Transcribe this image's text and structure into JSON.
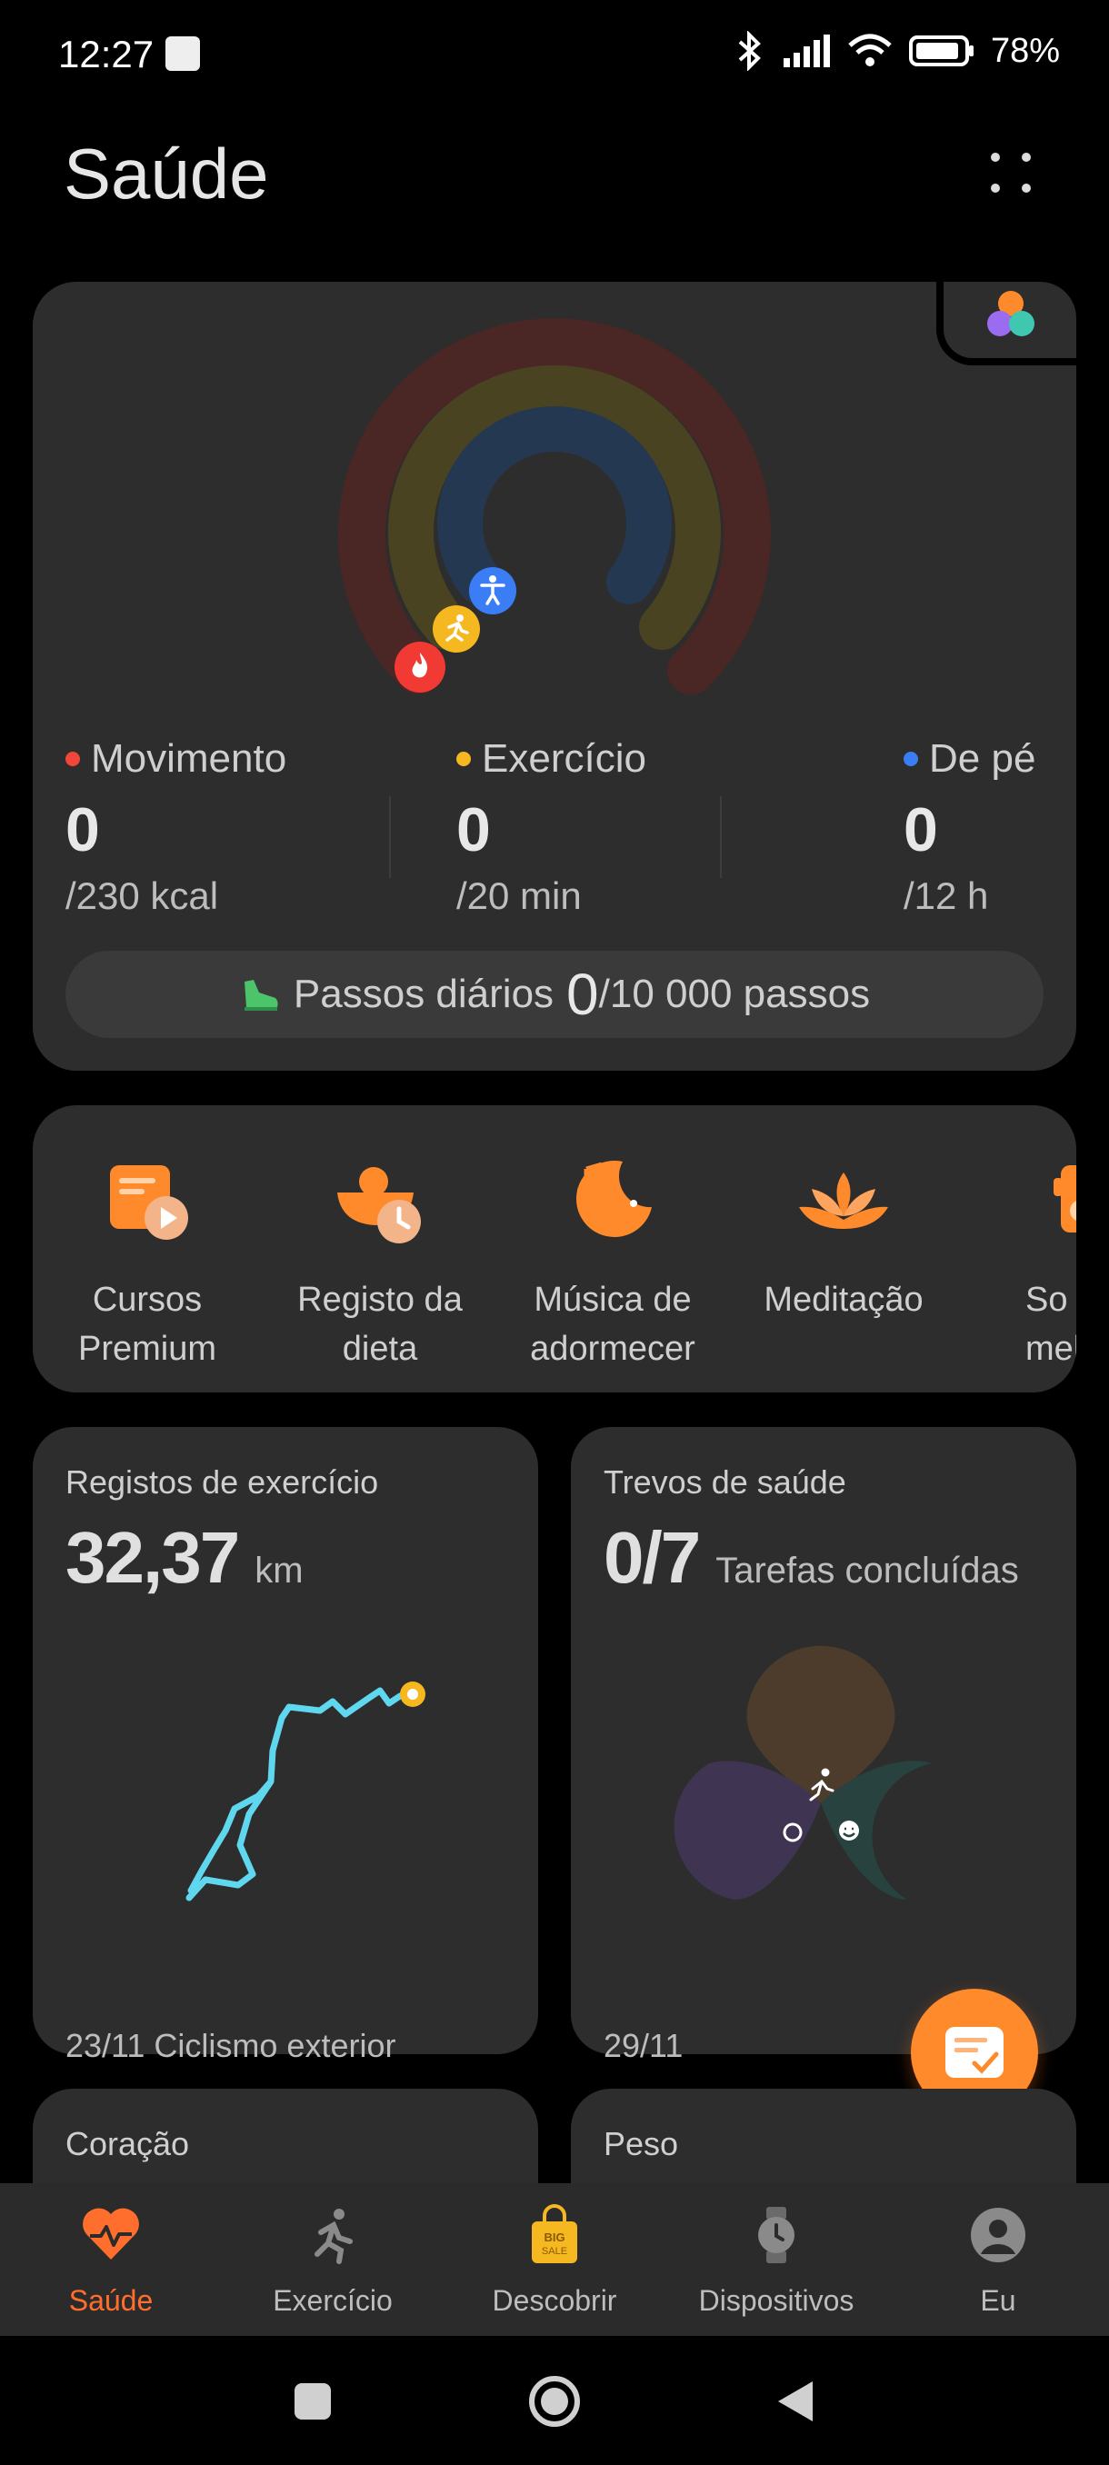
{
  "status_bar": {
    "time": "12:27",
    "battery": "78%"
  },
  "header": {
    "title": "Saúde"
  },
  "activity": {
    "stats": [
      {
        "label": "Movimento",
        "value": "0",
        "goal": "/230 kcal",
        "color": "#f0473a"
      },
      {
        "label": "Exercício",
        "value": "0",
        "goal": "/20 min",
        "color": "#f5b820"
      },
      {
        "label": "De pé",
        "value": "0",
        "goal": "/12 h",
        "color": "#3b7df5"
      }
    ],
    "steps": {
      "label": "Passos diários",
      "value": "0",
      "goal": "/10 000 passos"
    }
  },
  "shortcuts": [
    {
      "label_line1": "Cursos",
      "label_line2": "Premium"
    },
    {
      "label_line1": "Registo da",
      "label_line2": "dieta"
    },
    {
      "label_line1": "Música de",
      "label_line2": "adormecer"
    },
    {
      "label_line1": "Meditação",
      "label_line2": ""
    },
    {
      "label_line1": "So",
      "label_line2": "meló"
    }
  ],
  "exercise_tile": {
    "title": "Registos de exercício",
    "value": "32,37",
    "unit": "km",
    "footer": "23/11 Ciclismo exterior"
  },
  "clover_tile": {
    "title": "Trevos de saúde",
    "value": "0/7",
    "unit": "Tarefas concluídas",
    "footer": "29/11"
  },
  "heart_tile": {
    "title": "Coração"
  },
  "weight_tile": {
    "title": "Peso"
  },
  "bottom_nav": [
    {
      "label": "Saúde",
      "icon": "heart-pulse-icon"
    },
    {
      "label": "Exercício",
      "icon": "runner-icon"
    },
    {
      "label": "Descobrir",
      "icon": "shopping-bag-icon"
    },
    {
      "label": "Dispositivos",
      "icon": "watch-icon"
    },
    {
      "label": "Eu",
      "icon": "profile-icon"
    }
  ],
  "colors": {
    "accent": "#ff6e2c",
    "card": "#2d2d2d",
    "background": "#000000"
  }
}
